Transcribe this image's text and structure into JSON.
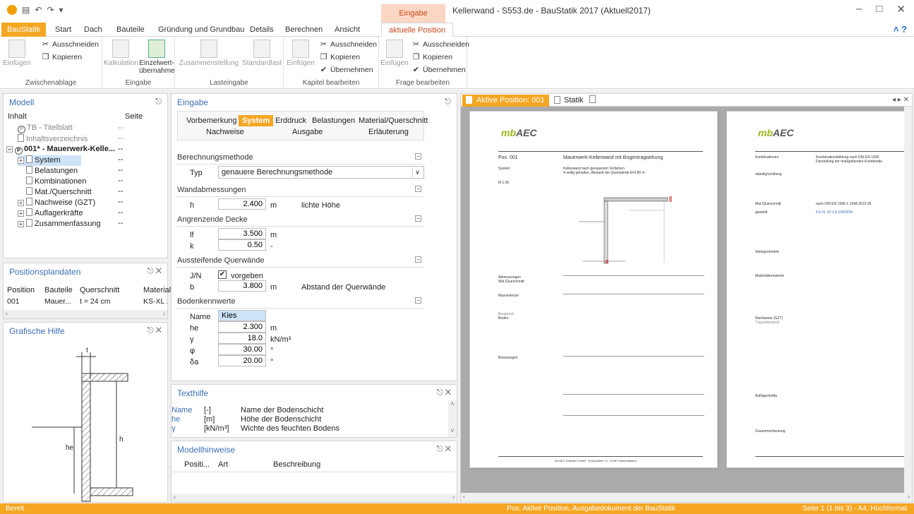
{
  "titlebar": {
    "title": "Kellerwand - S553.de - BauStatik 2017 (Aktuell2017)",
    "context_tab_group": "Eingabe"
  },
  "tabs": [
    "BauStatik",
    "Start",
    "Dach",
    "Bauteile",
    "Gründung und Grundbau",
    "Details",
    "Berechnen",
    "Ansicht",
    "aktuelle Position"
  ],
  "ribbon": {
    "groups": {
      "zwischenablage": "Zwischenablage",
      "eingabe": "Eingabe",
      "lasteingabe": "Lasteingabe",
      "kapitel": "Kapitel bearbeiten",
      "frage": "Frage bearbeiten"
    },
    "buttons": {
      "einfuegen": "Einfügen",
      "ausschneiden": "Ausschneiden",
      "kopieren": "Kopieren",
      "kalkulation": "Kalkulation",
      "einzelwert1": "Einzelwert-",
      "einzelwert2": "übernahme",
      "zusammenstellung": "Zusammenstellung",
      "standardlast": "Standardlast",
      "einfuegen2": "Einfügen",
      "ausschneiden2": "Ausschneiden",
      "kopieren2": "Kopieren",
      "uebernehmen2": "Übernehmen",
      "einfuegen3": "Einfügen",
      "ausschneiden3": "Ausschneiden",
      "kopieren3": "Kopieren",
      "uebernehmen3": "Übernehmen"
    }
  },
  "modell": {
    "title": "Modell",
    "col_inhalt": "Inhalt",
    "col_seite": "Seite",
    "items": [
      {
        "label": "TB - Titelblatt",
        "seite": "--"
      },
      {
        "label": "Inhaltsverzeichnis",
        "seite": "--"
      },
      {
        "label": "001* - Mauerwerk-Kelle...",
        "seite": "--"
      },
      {
        "label": "System",
        "seite": "--"
      },
      {
        "label": "Belastungen",
        "seite": "--"
      },
      {
        "label": "Kombinationen",
        "seite": "--"
      },
      {
        "label": "Mat./Querschnitt",
        "seite": "--"
      },
      {
        "label": "Nachweise (GZT)",
        "seite": "--"
      },
      {
        "label": "Auflagerkräfte",
        "seite": "--"
      },
      {
        "label": "Zusammenfassung",
        "seite": "--"
      }
    ]
  },
  "positionsplan": {
    "title": "Positionsplandaten",
    "columns": [
      "Position",
      "Bauteile",
      "Querschnitt",
      "Material"
    ],
    "row": [
      "001",
      "Mauer...",
      "t = 24 cm",
      "KS-XL 2("
    ]
  },
  "grafische_hilfe": {
    "title": "Grafische Hilfe",
    "lbl_t": "t",
    "lbl_h": "h",
    "lbl_he": "he"
  },
  "eingabe": {
    "title": "Eingabe",
    "nav": [
      "Vorbemerkung",
      "System",
      "Erddruck",
      "Belastungen",
      "Material/Querschnitt",
      "Nachweise",
      "Ausgabe",
      "Erläuterung"
    ],
    "berechnungsmethode": {
      "title": "Berechnungsmethode",
      "typ_label": "Typ",
      "typ_value": "genauere Berechnungsmethode"
    },
    "wandabmessungen": {
      "title": "Wandabmessungen",
      "h_label": "h",
      "h_value": "2.400",
      "h_unit": "m",
      "h_desc": "lichte Höhe"
    },
    "decke": {
      "title": "Angrenzende Decke",
      "lf_label": "lf",
      "lf_value": "3.500",
      "lf_unit": "m",
      "k_label": "k",
      "k_value": "0.50",
      "k_unit": "-"
    },
    "querwaende": {
      "title": "Aussteifende Querwände",
      "jn_label": "J/N",
      "jn_value": "vorgeben",
      "b_label": "b",
      "b_value": "3.800",
      "b_unit": "m",
      "b_desc": "Abstand der Querwände"
    },
    "boden": {
      "title": "Bodenkennwerte",
      "name_label": "Name",
      "name_value": "Kies",
      "he_label": "he",
      "he_value": "2.300",
      "he_unit": "m",
      "gamma_label": "γ",
      "gamma_value": "18.0",
      "gamma_unit": "kN/m³",
      "phi_label": "φ",
      "phi_value": "30.00",
      "phi_unit": "°",
      "delta_label": "δa",
      "delta_value": "20.00",
      "delta_unit": "°"
    }
  },
  "texthilfe": {
    "title": "Texthilfe",
    "rows": [
      {
        "name": "Name",
        "unit": "[-]",
        "desc": "Name der Bodenschicht"
      },
      {
        "name": "he",
        "unit": "[m]",
        "desc": "Höhe der Bodenschicht"
      },
      {
        "name": "γ",
        "unit": "[kN/m³]",
        "desc": "Wichte des feuchten Bodens"
      }
    ]
  },
  "modellhinweise": {
    "title": "Modellhinweise",
    "columns": [
      "Positi...",
      "Art",
      "Beschreibung"
    ]
  },
  "doc": {
    "tab_active": "Aktive Position: 001",
    "tab_statik": "Statik",
    "page1": {
      "pos_label": "Pos. 001",
      "pos_title": "Mauerwerk-Kellerwand mit Bogentragwirkung",
      "system": "System",
      "system_text1": "Kellerwand nach genauerem Verfahren",
      "system_text2": "4-seitig gehalten, Abstand der Querwände b=3.80 m",
      "scale": "M 1:35",
      "abm": "Abmessungen",
      "matq": "Mat./Querschnitt",
      "deck": "Massivdecke",
      "baugrund": "Baugrund",
      "boden": "Boden",
      "belast": "Belastungen",
      "footer": "mb AEC Software GmbH · Europaallee 14 · 67657 Kaiserslautern"
    },
    "page2": {
      "komb": "Kombinationen",
      "komb_t1": "Kombinationsbildung nach DIN EN 1990",
      "komb_t2": "Darstellung der maßgebenden Kombinatio",
      "staendig": "ständig/vorüberg.",
      "matq": "Mat./Querschnitt",
      "matq_t": "nach DIN EN 1996-1-1/NA 2012-05",
      "gewaehlt": "gewählt",
      "gewaehlt_t": "KS-XL 20-1,8 (240)/DM",
      "steingeo": "Steingeometrie",
      "matkenn": "Materialkennwerte",
      "nachweise": "Nachweise (GZT)",
      "tragwid": "Tragwiderstand",
      "auflager": "Auflagerkräfte",
      "zusammen": "Zusammenfassung"
    }
  },
  "status": {
    "left": "Bereit",
    "center": "Pos. Aktive Position, Ausgabedokument der BauStatik",
    "right": "Seite 1 (1 bis 3) - A4, Hochformat"
  },
  "colors": {
    "accent": "#f5a623",
    "context": "#c84a1c",
    "link": "#3c6fb5"
  }
}
